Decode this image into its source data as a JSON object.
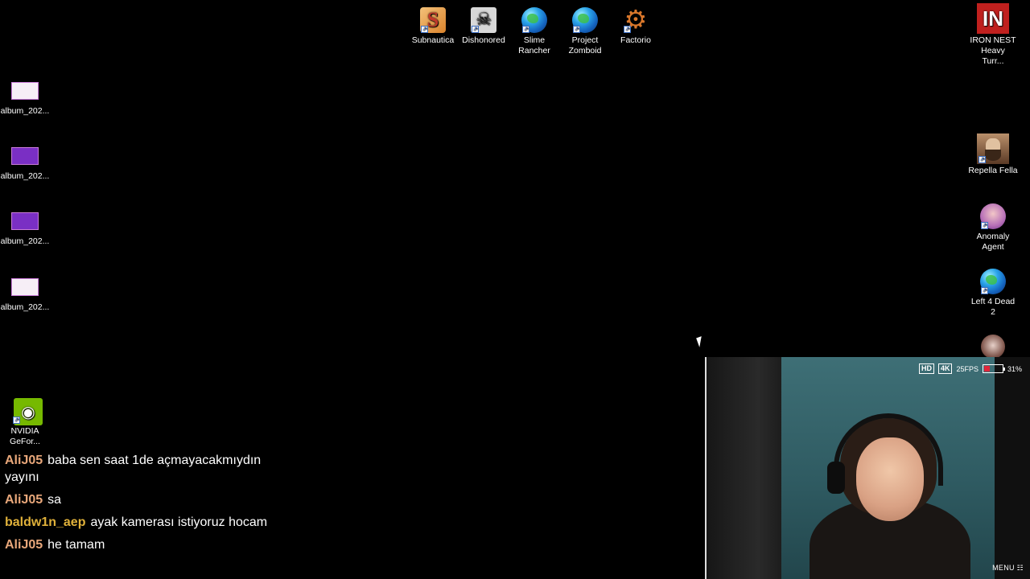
{
  "desktop": {
    "top_icons": [
      {
        "label": "Subnautica",
        "icon": "subnautica-icon"
      },
      {
        "label": "Dishonored",
        "icon": "dishonored-icon"
      },
      {
        "label": "Slime Rancher",
        "icon": "globe-icon"
      },
      {
        "label": "Project Zomboid",
        "icon": "globe-icon"
      },
      {
        "label": "Factorio",
        "icon": "gear-icon"
      }
    ],
    "left_icons": [
      {
        "label": "album_202..."
      },
      {
        "label": "album_202..."
      },
      {
        "label": "album_202..."
      },
      {
        "label": "album_202..."
      },
      {
        "label": "NVIDIA GeFor..."
      }
    ],
    "right_icons": [
      {
        "label": "IRON NEST Heavy Turr...",
        "logo_text": "IN"
      },
      {
        "label": "Repella Fella"
      },
      {
        "label": "Anomaly Agent"
      },
      {
        "label": "Left 4 Dead 2"
      }
    ]
  },
  "chat": {
    "messages": [
      {
        "user": "AliJ05",
        "text": "baba sen saat 1de açmayacakmıydın yayını",
        "color": "#e8a77a"
      },
      {
        "user": "AliJ05",
        "text": "sa",
        "color": "#e8a77a"
      },
      {
        "user": "baldw1n_aep",
        "text": "ayak kamerası istiyoruz hocam",
        "color": "#e0b13a"
      },
      {
        "user": "AliJ05",
        "text": "he tamam",
        "color": "#e8a77a"
      }
    ]
  },
  "webcam": {
    "hd_badge": "HD",
    "res_badge": "4K",
    "fps": "25FPS",
    "battery_percent": "31%",
    "battery_level": 0.31,
    "menu_label": "MENU"
  }
}
